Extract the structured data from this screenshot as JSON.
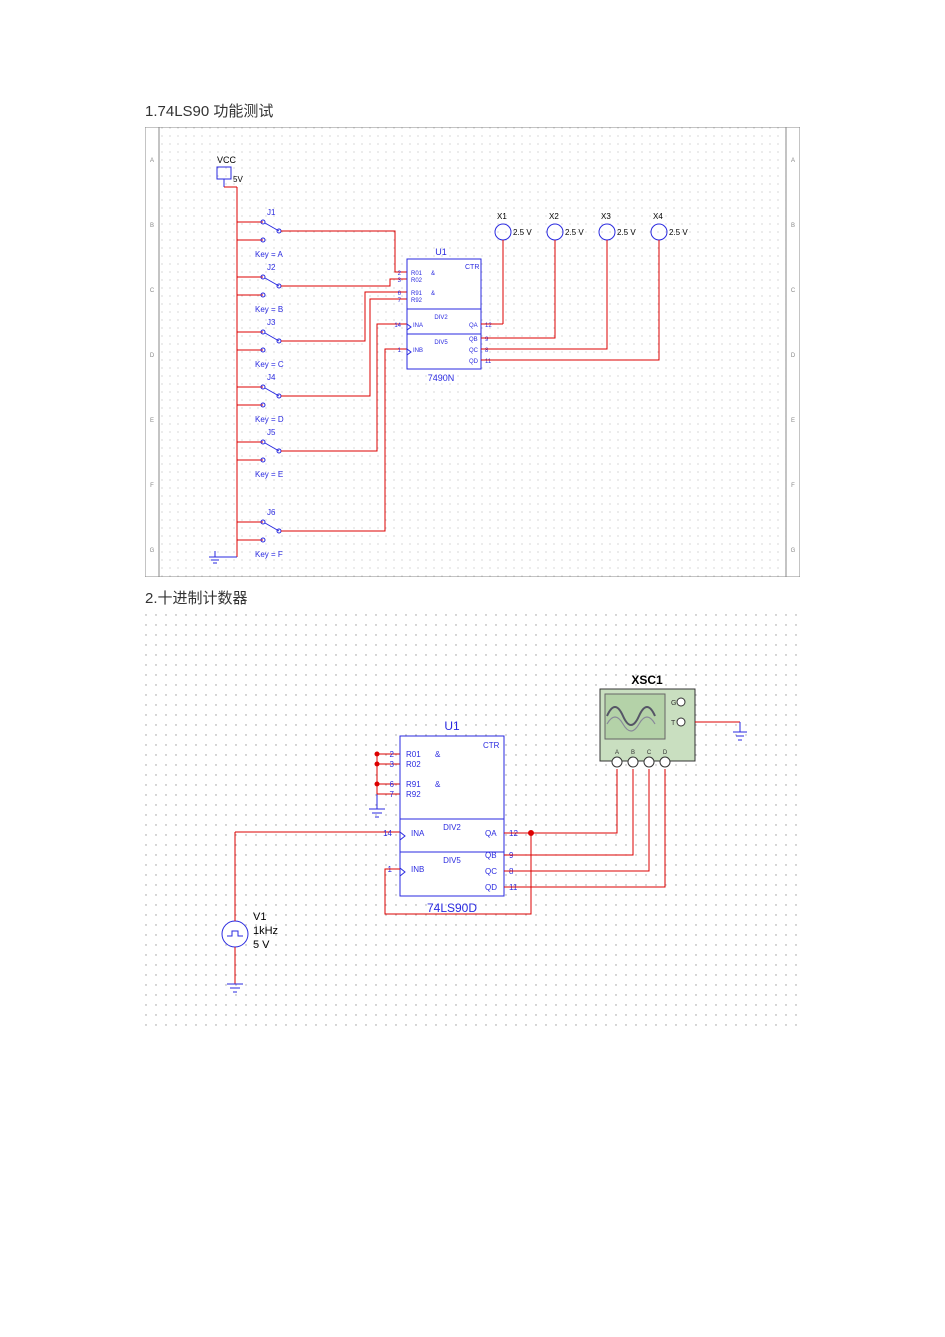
{
  "sections": {
    "s1_title": "1.74LS90 功能测试",
    "s2_title": "2.十进制计数器"
  },
  "circuit1": {
    "vcc_label": "VCC",
    "vcc_value": "5V",
    "switches": [
      {
        "ref": "J1",
        "key": "Key = A"
      },
      {
        "ref": "J2",
        "key": "Key = B"
      },
      {
        "ref": "J3",
        "key": "Key = C"
      },
      {
        "ref": "J4",
        "key": "Key = D"
      },
      {
        "ref": "J5",
        "key": "Key = E"
      },
      {
        "ref": "J6",
        "key": "Key = F"
      }
    ],
    "chip": {
      "ref": "U1",
      "part": "7490N",
      "ctr": "CTR",
      "pins_left": [
        {
          "num": "2",
          "name": "R01",
          "grp": "&"
        },
        {
          "num": "3",
          "name": "R02",
          "grp": ""
        },
        {
          "num": "6",
          "name": "R91",
          "grp": "&"
        },
        {
          "num": "7",
          "name": "R92",
          "grp": ""
        }
      ],
      "div2": "DIV2",
      "div5": "DIV5",
      "ina": {
        "num": "14",
        "name": "INA"
      },
      "inb": {
        "num": "1",
        "name": "INB"
      },
      "outs": [
        {
          "num": "12",
          "name": "QA"
        },
        {
          "num": "9",
          "name": "QB"
        },
        {
          "num": "8",
          "name": "QC"
        },
        {
          "num": "11",
          "name": "QD"
        }
      ]
    },
    "probes": [
      {
        "ref": "X1",
        "value": "2.5 V"
      },
      {
        "ref": "X2",
        "value": "2.5 V"
      },
      {
        "ref": "X3",
        "value": "2.5 V"
      },
      {
        "ref": "X4",
        "value": "2.5 V"
      }
    ],
    "ruler_left": [
      "A",
      "B",
      "C",
      "D",
      "E",
      "F",
      "G"
    ],
    "ruler_right": [
      "A",
      "B",
      "C",
      "D",
      "E",
      "F",
      "G"
    ]
  },
  "circuit2": {
    "chip": {
      "ref": "U1",
      "part": "74LS90D",
      "ctr": "CTR",
      "pins_left": [
        {
          "num": "2",
          "name": "R01",
          "grp": "&"
        },
        {
          "num": "3",
          "name": "R02",
          "grp": ""
        },
        {
          "num": "6",
          "name": "R91",
          "grp": "&"
        },
        {
          "num": "7",
          "name": "R92",
          "grp": ""
        }
      ],
      "div2": "DIV2",
      "div5": "DIV5",
      "ina": {
        "num": "14",
        "name": "INA"
      },
      "inb": {
        "num": "1",
        "name": "INB"
      },
      "outs": [
        {
          "num": "12",
          "name": "QA"
        },
        {
          "num": "9",
          "name": "QB"
        },
        {
          "num": "8",
          "name": "QC"
        },
        {
          "num": "11",
          "name": "QD"
        }
      ]
    },
    "source": {
      "ref": "V1",
      "freq": "1kHz",
      "amp": "5 V"
    },
    "scope": {
      "ref": "XSC1",
      "g": "G",
      "t": "T",
      "ch": [
        "A",
        "B",
        "C",
        "D"
      ]
    }
  }
}
